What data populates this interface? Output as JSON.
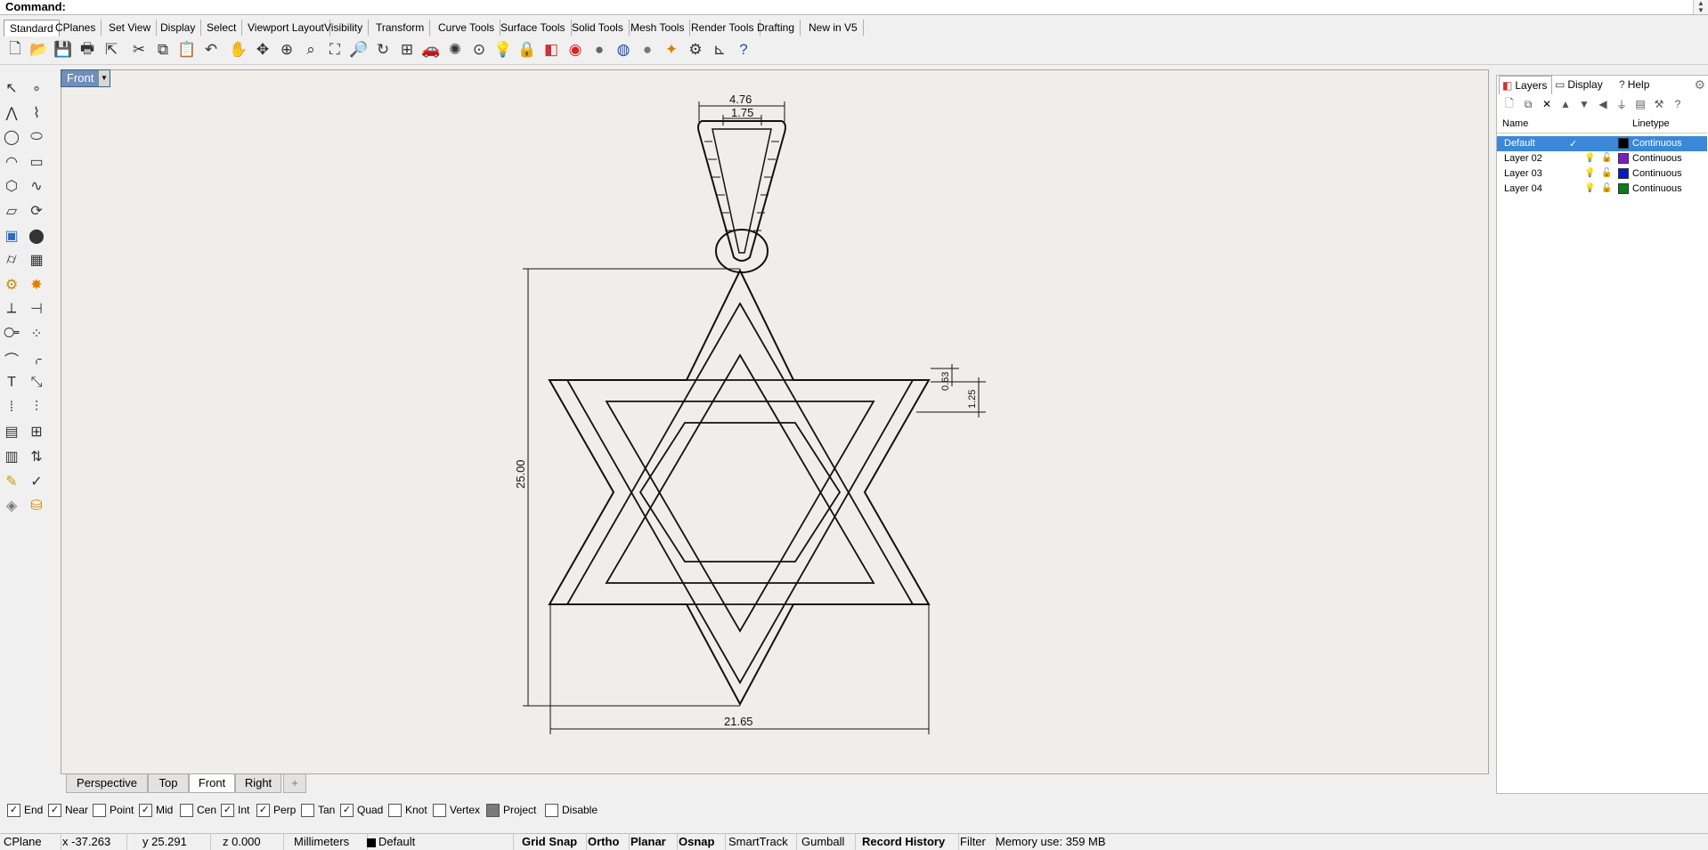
{
  "command": {
    "label": "Command:"
  },
  "tabs": [
    "Standard",
    "CPlanes",
    "Set View",
    "Display",
    "Select",
    "Viewport Layout",
    "Visibility",
    "Transform",
    "Curve Tools",
    "Surface Tools",
    "Solid Tools",
    "Mesh Tools",
    "Render Tools",
    "Drafting",
    "New in V5"
  ],
  "active_tab": "Standard",
  "toolbar_icons": [
    "new-file-icon",
    "open-folder-icon",
    "save-icon",
    "print-icon",
    "import-icon",
    "cut-icon",
    "copy-icon",
    "paste-icon",
    "undo-icon",
    "pan-hand-icon",
    "rotate-view-icon",
    "zoom-in-icon",
    "zoom-window-icon",
    "zoom-extents-icon",
    "zoom-selected-icon",
    "zoom-dynamic-icon",
    "four-viewports-icon",
    "car-render-icon",
    "light-icon",
    "point-icon",
    "bulb-icon",
    "lock-icon",
    "layer-icon",
    "color-wheel-icon",
    "shade-icon",
    "render-sphere-icon",
    "material-sphere-icon",
    "snap-wand-icon",
    "settings-gear-icon",
    "dimension-icon",
    "help-icon"
  ],
  "left_tools": [
    "select-arrow-icon",
    "point-tool-icon",
    "polyline-icon",
    "control-point-curve-icon",
    "circle-icon",
    "ellipse-icon",
    "arc-icon",
    "rectangle-icon",
    "polygon-icon",
    "freeform-curve-icon",
    "surface-icon",
    "revolve-icon",
    "box-icon",
    "sphere-icon",
    "cylinder-icon",
    "mesh-plane-icon",
    "gear-tool-icon",
    "explode-icon",
    "trim-icon",
    "split-icon",
    "boolean-icon",
    "edit-points-icon",
    "fillet-icon",
    "chamfer-icon",
    "text-tool-icon",
    "scale-icon",
    "array-icon",
    "align-icon",
    "block-icon",
    "grid-icon",
    "matrix-icon",
    "sort-icon",
    "paint-icon",
    "check-icon",
    "cube-icon",
    "bucket-icon"
  ],
  "viewport": {
    "label": "Front",
    "dimensions": {
      "top_width": "4.76",
      "inner_width": "1.75",
      "height": "25.00",
      "bottom_width": "21.65",
      "band": "0.63",
      "band2": "1.25"
    }
  },
  "viewport_tabs": [
    "Perspective",
    "Top",
    "Front",
    "Right"
  ],
  "active_viewport": "Front",
  "add_viewport_symbol": "+",
  "osnaps": [
    {
      "label": "End",
      "checked": true
    },
    {
      "label": "Near",
      "checked": true
    },
    {
      "label": "Point",
      "checked": false
    },
    {
      "label": "Mid",
      "checked": true
    },
    {
      "label": "Cen",
      "checked": false
    },
    {
      "label": "Int",
      "checked": true
    },
    {
      "label": "Perp",
      "checked": true
    },
    {
      "label": "Tan",
      "checked": false
    },
    {
      "label": "Quad",
      "checked": true
    },
    {
      "label": "Knot",
      "checked": false
    },
    {
      "label": "Vertex",
      "checked": false
    },
    {
      "label": "Project",
      "checked": false,
      "filled": true
    },
    {
      "label": "Disable",
      "checked": false
    }
  ],
  "status": {
    "cplane": "CPlane",
    "x": "x -37.263",
    "y": "y 25.291",
    "z": "z 0.000",
    "units": "Millimeters",
    "layer": "Default",
    "grid_snap": "Grid Snap",
    "ortho": "Ortho",
    "planar": "Planar",
    "osnap": "Osnap",
    "smarttrack": "SmartTrack",
    "gumball": "Gumball",
    "record_history": "Record History",
    "filter": "Filter",
    "memory": "Memory use: 359 MB"
  },
  "panel": {
    "tabs": [
      {
        "label": "Layers",
        "icon": "layers-icon"
      },
      {
        "label": "Display",
        "icon": "display-monitor-icon"
      },
      {
        "label": "Help",
        "icon": "help-book-icon"
      }
    ],
    "toolbar": [
      "new-layer-icon",
      "new-sublayer-icon",
      "delete-layer-icon",
      "move-up-icon",
      "move-down-icon",
      "collapse-icon",
      "filter-icon",
      "layer-tools-icon",
      "layer-settings-icon",
      "layer-help-icon"
    ],
    "columns": {
      "name": "Name",
      "linetype": "Linetype"
    },
    "layers": [
      {
        "name": "Default",
        "current": true,
        "color": "#000000",
        "linetype": "Continuous"
      },
      {
        "name": "Layer 02",
        "current": false,
        "color": "#7a1fbf",
        "linetype": "Continuous"
      },
      {
        "name": "Layer 03",
        "current": false,
        "color": "#0b17c9",
        "linetype": "Continuous"
      },
      {
        "name": "Layer 04",
        "current": false,
        "color": "#0d7a1b",
        "linetype": "Continuous"
      }
    ]
  }
}
